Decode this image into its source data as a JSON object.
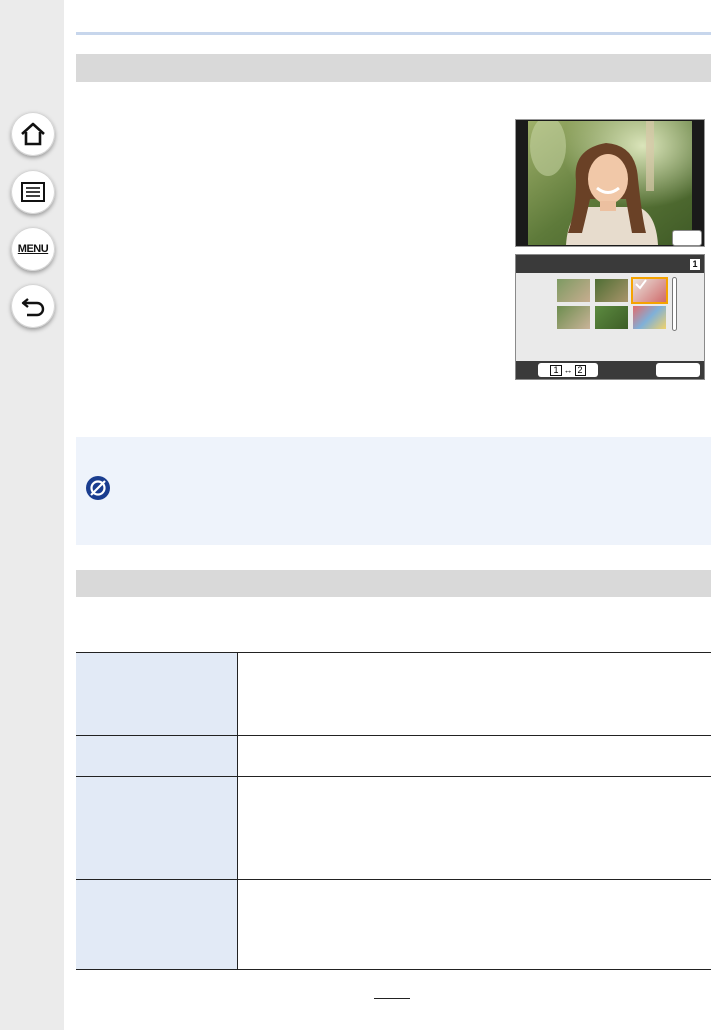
{
  "sidebar": {
    "home_icon": "home-icon",
    "contents_icon": "list-icon",
    "menu_label": "MENU",
    "back_icon": "back-arrow-icon"
  },
  "preview": {
    "grid_page_badge": "1",
    "grid_toggle_from": "1",
    "grid_toggle_to": "2"
  },
  "note": {
    "icon": "not-available-icon"
  },
  "table": {
    "rows": 4
  },
  "colors": {
    "sidebar_bg": "#ebebeb",
    "section_bar": "#d9d9d9",
    "note_bg": "#eef3fb",
    "table_head_bg": "#e2eaf6",
    "accent_blue": "#1a3d8f",
    "selection_orange": "#f5a300"
  }
}
